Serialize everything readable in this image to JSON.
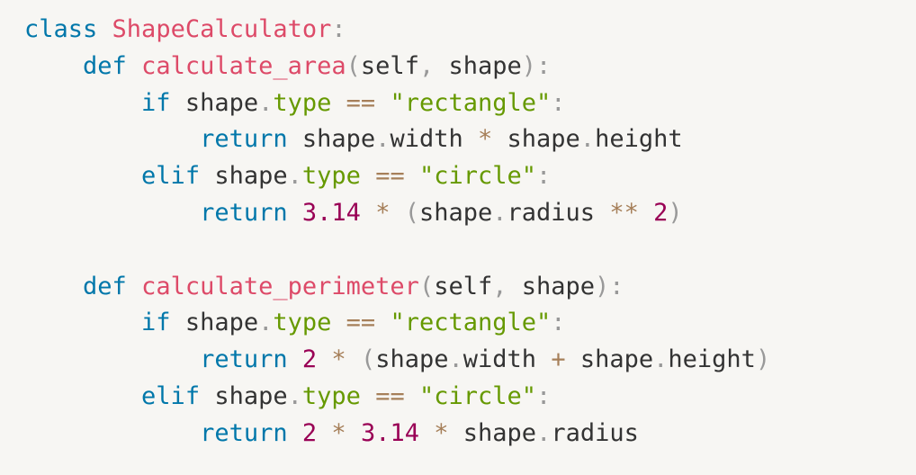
{
  "code_block": {
    "language": "python",
    "colors": {
      "background": "#f7f6f3",
      "keyword": "#0077aa",
      "function": "#dd4a68",
      "punctuation": "#999999",
      "plain": "#333333",
      "attribute": "#669900",
      "operator": "#a67f59",
      "string": "#669900",
      "number": "#990055"
    },
    "lines": [
      [
        {
          "t": "class",
          "k": "kw"
        },
        {
          "t": " ",
          "k": "plain"
        },
        {
          "t": "ShapeCalculator",
          "k": "fn"
        },
        {
          "t": ":",
          "k": "punc"
        }
      ],
      [
        {
          "t": "    ",
          "k": "plain"
        },
        {
          "t": "def",
          "k": "kw"
        },
        {
          "t": " ",
          "k": "plain"
        },
        {
          "t": "calculate_area",
          "k": "fn"
        },
        {
          "t": "(",
          "k": "punc"
        },
        {
          "t": "self",
          "k": "plain"
        },
        {
          "t": ",",
          "k": "punc"
        },
        {
          "t": " shape",
          "k": "plain"
        },
        {
          "t": "):",
          "k": "punc"
        }
      ],
      [
        {
          "t": "        ",
          "k": "plain"
        },
        {
          "t": "if",
          "k": "kw"
        },
        {
          "t": " shape",
          "k": "plain"
        },
        {
          "t": ".",
          "k": "punc"
        },
        {
          "t": "type",
          "k": "attr"
        },
        {
          "t": " ",
          "k": "plain"
        },
        {
          "t": "==",
          "k": "op"
        },
        {
          "t": " ",
          "k": "plain"
        },
        {
          "t": "\"rectangle\"",
          "k": "str"
        },
        {
          "t": ":",
          "k": "punc"
        }
      ],
      [
        {
          "t": "            ",
          "k": "plain"
        },
        {
          "t": "return",
          "k": "kw"
        },
        {
          "t": " shape",
          "k": "plain"
        },
        {
          "t": ".",
          "k": "punc"
        },
        {
          "t": "width",
          "k": "plain"
        },
        {
          "t": " ",
          "k": "plain"
        },
        {
          "t": "*",
          "k": "op"
        },
        {
          "t": " shape",
          "k": "plain"
        },
        {
          "t": ".",
          "k": "punc"
        },
        {
          "t": "height",
          "k": "plain"
        }
      ],
      [
        {
          "t": "        ",
          "k": "plain"
        },
        {
          "t": "elif",
          "k": "kw"
        },
        {
          "t": " shape",
          "k": "plain"
        },
        {
          "t": ".",
          "k": "punc"
        },
        {
          "t": "type",
          "k": "attr"
        },
        {
          "t": " ",
          "k": "plain"
        },
        {
          "t": "==",
          "k": "op"
        },
        {
          "t": " ",
          "k": "plain"
        },
        {
          "t": "\"circle\"",
          "k": "str"
        },
        {
          "t": ":",
          "k": "punc"
        }
      ],
      [
        {
          "t": "            ",
          "k": "plain"
        },
        {
          "t": "return",
          "k": "kw"
        },
        {
          "t": " ",
          "k": "plain"
        },
        {
          "t": "3.14",
          "k": "num"
        },
        {
          "t": " ",
          "k": "plain"
        },
        {
          "t": "*",
          "k": "op"
        },
        {
          "t": " ",
          "k": "plain"
        },
        {
          "t": "(",
          "k": "punc"
        },
        {
          "t": "shape",
          "k": "plain"
        },
        {
          "t": ".",
          "k": "punc"
        },
        {
          "t": "radius",
          "k": "plain"
        },
        {
          "t": " ",
          "k": "plain"
        },
        {
          "t": "**",
          "k": "op"
        },
        {
          "t": " ",
          "k": "plain"
        },
        {
          "t": "2",
          "k": "num"
        },
        {
          "t": ")",
          "k": "punc"
        }
      ],
      [],
      [
        {
          "t": "    ",
          "k": "plain"
        },
        {
          "t": "def",
          "k": "kw"
        },
        {
          "t": " ",
          "k": "plain"
        },
        {
          "t": "calculate_perimeter",
          "k": "fn"
        },
        {
          "t": "(",
          "k": "punc"
        },
        {
          "t": "self",
          "k": "plain"
        },
        {
          "t": ",",
          "k": "punc"
        },
        {
          "t": " shape",
          "k": "plain"
        },
        {
          "t": "):",
          "k": "punc"
        }
      ],
      [
        {
          "t": "        ",
          "k": "plain"
        },
        {
          "t": "if",
          "k": "kw"
        },
        {
          "t": " shape",
          "k": "plain"
        },
        {
          "t": ".",
          "k": "punc"
        },
        {
          "t": "type",
          "k": "attr"
        },
        {
          "t": " ",
          "k": "plain"
        },
        {
          "t": "==",
          "k": "op"
        },
        {
          "t": " ",
          "k": "plain"
        },
        {
          "t": "\"rectangle\"",
          "k": "str"
        },
        {
          "t": ":",
          "k": "punc"
        }
      ],
      [
        {
          "t": "            ",
          "k": "plain"
        },
        {
          "t": "return",
          "k": "kw"
        },
        {
          "t": " ",
          "k": "plain"
        },
        {
          "t": "2",
          "k": "num"
        },
        {
          "t": " ",
          "k": "plain"
        },
        {
          "t": "*",
          "k": "op"
        },
        {
          "t": " ",
          "k": "plain"
        },
        {
          "t": "(",
          "k": "punc"
        },
        {
          "t": "shape",
          "k": "plain"
        },
        {
          "t": ".",
          "k": "punc"
        },
        {
          "t": "width",
          "k": "plain"
        },
        {
          "t": " ",
          "k": "plain"
        },
        {
          "t": "+",
          "k": "op"
        },
        {
          "t": " shape",
          "k": "plain"
        },
        {
          "t": ".",
          "k": "punc"
        },
        {
          "t": "height",
          "k": "plain"
        },
        {
          "t": ")",
          "k": "punc"
        }
      ],
      [
        {
          "t": "        ",
          "k": "plain"
        },
        {
          "t": "elif",
          "k": "kw"
        },
        {
          "t": " shape",
          "k": "plain"
        },
        {
          "t": ".",
          "k": "punc"
        },
        {
          "t": "type",
          "k": "attr"
        },
        {
          "t": " ",
          "k": "plain"
        },
        {
          "t": "==",
          "k": "op"
        },
        {
          "t": " ",
          "k": "plain"
        },
        {
          "t": "\"circle\"",
          "k": "str"
        },
        {
          "t": ":",
          "k": "punc"
        }
      ],
      [
        {
          "t": "            ",
          "k": "plain"
        },
        {
          "t": "return",
          "k": "kw"
        },
        {
          "t": " ",
          "k": "plain"
        },
        {
          "t": "2",
          "k": "num"
        },
        {
          "t": " ",
          "k": "plain"
        },
        {
          "t": "*",
          "k": "op"
        },
        {
          "t": " ",
          "k": "plain"
        },
        {
          "t": "3.14",
          "k": "num"
        },
        {
          "t": " ",
          "k": "plain"
        },
        {
          "t": "*",
          "k": "op"
        },
        {
          "t": " shape",
          "k": "plain"
        },
        {
          "t": ".",
          "k": "punc"
        },
        {
          "t": "radius",
          "k": "plain"
        }
      ]
    ]
  }
}
